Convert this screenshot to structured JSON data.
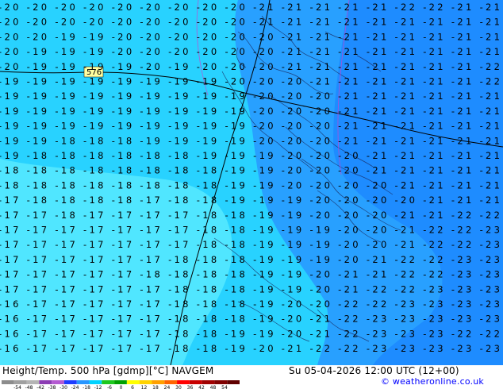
{
  "footer": {
    "title": "Height/Temp. 500 hPa [gdmp][°C] NAVGEM",
    "datetime": "Su 05-04-2026 12:00 UTC (12+00)",
    "copyright": "© weatheronline.co.uk"
  },
  "colorbar": {
    "ticks": [
      "-54",
      "-48",
      "-42",
      "-38",
      "-30",
      "-24",
      "-18",
      "-12",
      "-6",
      "0",
      "6",
      "12",
      "18",
      "24",
      "30",
      "36",
      "42",
      "48",
      "54"
    ],
    "colors": [
      "#8c8c8c",
      "#a0a0a0",
      "#b4b4b4",
      "#8c3cb4",
      "#b45ad2",
      "#1e3cff",
      "#2896ff",
      "#00d2ff",
      "#1ec81e",
      "#00a000",
      "#ffff00",
      "#ffd200",
      "#ffa000",
      "#ff6400",
      "#ff0000",
      "#c80000",
      "#a00000",
      "#800000",
      "#600000"
    ]
  },
  "map": {
    "contour_label": "576",
    "colors": {
      "cold": "#1e8cff",
      "mid": "#28a0ff",
      "cyan": "#28d2ff",
      "light": "#50e6ff"
    },
    "rows": [
      "-20  -20  -20  -20  -20  -20  -20  -20  -20  -21  -21  -21  -21  -21  -22  -22  -21  -21",
      "-20  -20  -20  -20  -20  -20  -20  -20  -20  -21  -21  -21  -21  -21  -21  -21  -21  -21",
      "-20  -20  -19  -19  -20  -20  -20  -20  -20  -20  -21  -21  -21  -21  -21  -21  -21  -21",
      "-20  -19  -19  -19  -20  -20  -20  -20  -20  -20  -21  -21  -21  -21  -21  -21  -21  -21",
      "-20  -19  -19  -19  -19  -20  -19  -20  -20  -20  -21  -21  -21  -21  -21  -21  -21  -22",
      "-19  -19  -19  -19  -19  -19  -19  -19  -20  -20  -20  -21  -21  -21  -21  -21  -21  -22",
      "-19  -19  -19  -19  -19  -19  -19  -19  -19  -20  -20  -20  -21  -21  -21  -21  -21  -21",
      "-19  -19  -19  -19  -19  -19  -19  -19  -19  -20  -20  -20  -21  -21  -21  -21  -21  -21",
      "-19  -19  -19  -19  -19  -19  -19  -19  -19  -20  -20  -20  -21  -21  -21  -21  -21  -21",
      "-19  -19  -18  -18  -18  -19  -19  -19  -19  -20  -20  -20  -21  -21  -21  -21  -21  -21",
      "-19  -18  -18  -18  -18  -18  -18  -19  -19  -19  -20  -20  -20  -21  -21  -21  -21  -21",
      "-18  -18  -18  -18  -18  -18  -18  -18  -19  -19  -20  -20  -20  -21  -21  -21  -21  -21",
      "-18  -18  -18  -18  -18  -18  -18  -18  -19  -19  -20  -20  -20  -20  -21  -21  -21  -21",
      "-17  -18  -18  -18  -18  -17  -18  -18  -19  -19  -19  -20  -20  -20  -20  -21  -21  -21",
      "-17  -17  -18  -17  -17  -17  -17  -18  -18  -19  -19  -20  -20  -20  -21  -21  -22  -22",
      "-17  -17  -17  -17  -17  -17  -17  -18  -18  -19  -19  -19  -20  -20  -21  -22  -22  -23",
      "-17  -17  -17  -17  -17  -17  -17  -18  -18  -19  -19  -19  -20  -20  -21  -22  -22  -23",
      "-17  -17  -17  -17  -17  -17  -18  -18  -18  -19  -19  -19  -20  -21  -22  -22  -23  -23",
      "-17  -17  -17  -17  -17  -18  -18  -18  -18  -19  -19  -20  -21  -21  -22  -22  -23  -23",
      "-17  -17  -17  -17  -17  -17  -18  -18  -18  -19  -19  -20  -21  -22  -22  -23  -23  -23",
      "-16  -17  -17  -17  -17  -17  -18  -18  -18  -19  -20  -20  -22  -22  -23  -23  -23  -23",
      "-16  -17  -17  -17  -17  -17  -18  -18  -18  -19  -20  -21  -22  -23  -23  -23  -23  -23",
      "-16  -17  -17  -17  -17  -17  -18  -18  -19  -19  -20  -21  -22  -23  -23  -23  -22  -22",
      "-16  -17  -17  -17  -17  -17  -18  -18  -19  -20  -21  -22  -22  -23  -23  -23  -23  -23"
    ]
  }
}
